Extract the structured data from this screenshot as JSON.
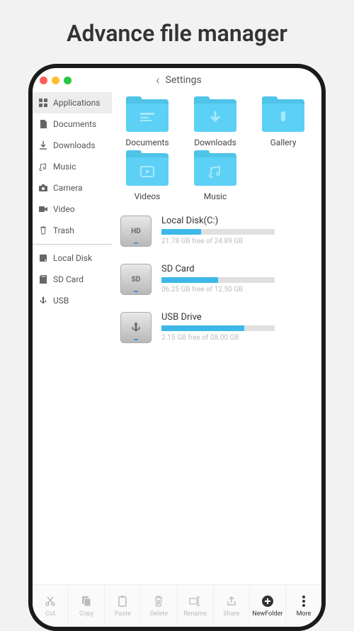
{
  "page_title": "Advance file manager",
  "topbar": {
    "back_label": "Settings"
  },
  "sidebar": {
    "items": [
      {
        "icon": "grid-icon",
        "label": "Applications",
        "active": true
      },
      {
        "icon": "doc-icon",
        "label": "Documents"
      },
      {
        "icon": "download-icon",
        "label": "Downloads"
      },
      {
        "icon": "music-icon",
        "label": "Music"
      },
      {
        "icon": "camera-icon",
        "label": "Camera"
      },
      {
        "icon": "video-icon",
        "label": "Video"
      },
      {
        "icon": "trash-icon",
        "label": "Trash"
      }
    ],
    "storage_items": [
      {
        "icon": "disk-icon",
        "label": "Local Disk"
      },
      {
        "icon": "sdcard-icon",
        "label": "SD Card"
      },
      {
        "icon": "usb-icon",
        "label": "USB"
      }
    ]
  },
  "folders": [
    {
      "label": "Documents",
      "glyph": "documents"
    },
    {
      "label": "Downloads",
      "glyph": "download"
    },
    {
      "label": "Gallery",
      "glyph": "gallery"
    },
    {
      "label": "Videos",
      "glyph": "video"
    },
    {
      "label": "Music",
      "glyph": "music"
    }
  ],
  "drives": [
    {
      "name": "Local Disk(C:)",
      "badge": "HD",
      "free": "21.78 GB free of 24.89 GB",
      "used_pct": 35
    },
    {
      "name": "SD Card",
      "badge": "SD",
      "free": "06.25 GB free of 12.50 GB",
      "used_pct": 50
    },
    {
      "name": "USB Drive",
      "badge": "usb",
      "free": "2.15 GB free of 08.00 GB",
      "used_pct": 73
    }
  ],
  "bottombar": [
    {
      "label": "Cut",
      "icon": "cut-icon"
    },
    {
      "label": "Copy",
      "icon": "copy-icon"
    },
    {
      "label": "Paste",
      "icon": "paste-icon"
    },
    {
      "label": "Delete",
      "icon": "delete-icon"
    },
    {
      "label": "Rename",
      "icon": "rename-icon"
    },
    {
      "label": "Share",
      "icon": "share-icon"
    },
    {
      "label": "NewFolder",
      "icon": "newfolder-icon",
      "dark": true
    },
    {
      "label": "More",
      "icon": "more-icon",
      "dark": true
    }
  ]
}
